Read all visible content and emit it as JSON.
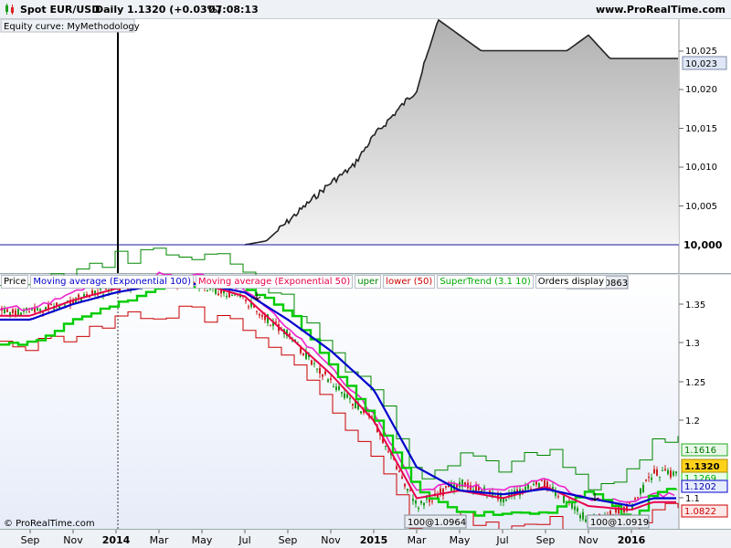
{
  "titlebar": {
    "instrument": "Spot EUR/USD",
    "timeframe": "Daily",
    "price": "1.1320 (+0.03%)",
    "time": "07:08:13",
    "url": "www.ProRealTime.com"
  },
  "colors": {
    "ema100": "#0000cc",
    "ema50": "#e8004c",
    "upper": "#ee22cc",
    "lower": "#cc0000",
    "supertrend": "#00cc00",
    "channel": "#008800",
    "equity_line": "#222222",
    "baseline": "#1a1a9a"
  },
  "equity_pane": {
    "label": "Equity curve: MyMethodology",
    "tick_labels": [
      "10,025",
      "10,020",
      "10,015",
      "10,010",
      "10,005"
    ],
    "current_value": "10,023",
    "base_value": "10,000"
  },
  "price_pane": {
    "legend": [
      "Price",
      "Moving average (Exponential 100)",
      "Moving average (Exponential 50)",
      "uper",
      "lower (50)",
      "SuperTrend (3.1 10)",
      "Orders display"
    ],
    "tick_labels": [
      "1.35",
      "1.3",
      "1.25",
      "1.2",
      "1.1"
    ],
    "value_badges": [
      "1.1616",
      "1.1320",
      "1.1269",
      "1.1202",
      "1.0822"
    ],
    "order_labels": [
      "100@1.0863",
      "100@1.0964",
      "100@1.0919"
    ],
    "watermark": "© ProRealTime.com"
  },
  "time_axis": [
    "Sep",
    "Nov",
    "2014",
    "Mar",
    "May",
    "Jul",
    "Sep",
    "Nov",
    "2015",
    "Mar",
    "May",
    "Jul",
    "Sep",
    "Nov",
    "2016"
  ],
  "chart_data": [
    {
      "type": "area",
      "title": "Equity curve: MyMethodology",
      "x": [
        "2014-07",
        "2014-08",
        "2014-09",
        "2014-10",
        "2014-11",
        "2014-12",
        "2015-01",
        "2015-02",
        "2015-03",
        "2015-04",
        "2015-06",
        "2015-09",
        "2015-10",
        "2015-11",
        "2015-12",
        "2016-02"
      ],
      "values": [
        10000,
        10000.5,
        10003,
        10005.5,
        10008,
        10010,
        10014,
        10017,
        10020,
        10029,
        10025,
        10025,
        10025,
        10027,
        10024,
        10024
      ],
      "ylim": [
        10000,
        10029
      ],
      "series": [
        {
          "name": "Equity curve: MyMethodology",
          "values": [
            10000,
            10000.5,
            10003,
            10005.5,
            10008,
            10010,
            10014,
            10017,
            10020,
            10029,
            10025,
            10025,
            10025,
            10027,
            10024,
            10024
          ]
        }
      ]
    },
    {
      "type": "line",
      "title": "Spot EUR/USD",
      "x": [
        "2013-09",
        "2013-11",
        "2014-01",
        "2014-03",
        "2014-05",
        "2014-07",
        "2014-09",
        "2014-11",
        "2015-01",
        "2015-03",
        "2015-05",
        "2015-07",
        "2015-09",
        "2015-11",
        "2016-01",
        "2016-02"
      ],
      "ylim": [
        1.06,
        1.385
      ],
      "series": [
        {
          "name": "Price",
          "values": [
            1.34,
            1.355,
            1.37,
            1.38,
            1.375,
            1.355,
            1.31,
            1.25,
            1.2,
            1.09,
            1.12,
            1.1,
            1.12,
            1.07,
            1.09,
            1.132
          ]
        },
        {
          "name": "Moving average (Exponential 100)",
          "values": [
            1.33,
            1.35,
            1.365,
            1.375,
            1.376,
            1.365,
            1.33,
            1.29,
            1.24,
            1.14,
            1.11,
            1.105,
            1.112,
            1.1,
            1.09,
            1.1
          ]
        },
        {
          "name": "Moving average (Exponential 50)",
          "values": [
            1.335,
            1.355,
            1.37,
            1.378,
            1.376,
            1.36,
            1.31,
            1.26,
            1.2,
            1.1,
            1.11,
            1.1,
            1.115,
            1.09,
            1.085,
            1.095
          ]
        },
        {
          "name": "SuperTrend (3.1 10)",
          "values": [
            1.3,
            1.33,
            1.35,
            1.37,
            1.375,
            1.37,
            1.34,
            1.27,
            1.2,
            1.11,
            1.08,
            1.08,
            1.08,
            1.11,
            1.07,
            1.11
          ]
        }
      ]
    }
  ]
}
